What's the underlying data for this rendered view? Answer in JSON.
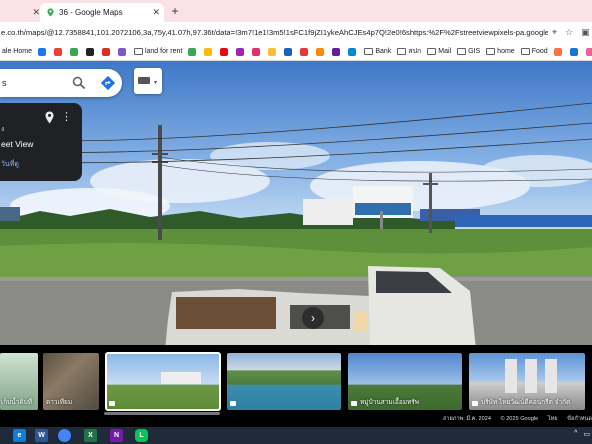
{
  "browser": {
    "tabs": [
      {
        "title": "",
        "active": false
      },
      {
        "title": "36 - Google Maps",
        "active": true
      }
    ],
    "url": "e.co.th/maps/@12.7358841,101.2072106,3a,75y,41.07h,97.36t/data=!3m7!1e1!3m5!1sFC1f9jZI1ykeAhCJEs4p7Q!2e0!6shttps:%2F%2Fstreetviewpixels-pa.googleapis.com%2..."
  },
  "bookmarks": [
    {
      "label": "ale Home",
      "icon": "home",
      "color": "#1a73e8"
    },
    {
      "label": "",
      "icon": "facebook-icon",
      "color": "#1877f2"
    },
    {
      "label": "",
      "icon": "google-icon",
      "color": "#ea4335"
    },
    {
      "label": "",
      "icon": "drive-icon",
      "color": "#34a853"
    },
    {
      "label": "",
      "icon": "s-icon",
      "color": "#222222"
    },
    {
      "label": "",
      "icon": "mail-icon",
      "color": "#d93025"
    },
    {
      "label": "",
      "icon": "app-icon",
      "color": "#7e57c2"
    },
    {
      "label": "land for rent",
      "icon": "folder",
      "color": "#5f6368"
    },
    {
      "label": "",
      "icon": "app-icon",
      "color": "#34a853"
    },
    {
      "label": "",
      "icon": "app-icon",
      "color": "#fbbc04"
    },
    {
      "label": "",
      "icon": "netflix-icon",
      "color": "#e50914"
    },
    {
      "label": "",
      "icon": "app-icon",
      "color": "#9c27b0"
    },
    {
      "label": "",
      "icon": "instagram-icon",
      "color": "#e1306c"
    },
    {
      "label": "",
      "icon": "app-icon",
      "color": "#fbc02d"
    },
    {
      "label": "",
      "icon": "app-icon",
      "color": "#1565c0"
    },
    {
      "label": "",
      "icon": "app-icon",
      "color": "#e53935"
    },
    {
      "label": "",
      "icon": "app-icon",
      "color": "#fb8c00"
    },
    {
      "label": "",
      "icon": "app-icon",
      "color": "#6a1b9a"
    },
    {
      "label": "",
      "icon": "app-icon",
      "color": "#0288d1"
    },
    {
      "label": "Bank",
      "icon": "folder",
      "color": "#5f6368"
    },
    {
      "label": "สปก",
      "icon": "folder",
      "color": "#5f6368"
    },
    {
      "label": "Mail",
      "icon": "folder",
      "color": "#5f6368"
    },
    {
      "label": "GIS",
      "icon": "folder",
      "color": "#5f6368"
    },
    {
      "label": "home",
      "icon": "folder",
      "color": "#5f6368"
    },
    {
      "label": "Food",
      "icon": "folder",
      "color": "#5f6368"
    },
    {
      "label": "",
      "icon": "app-icon",
      "color": "#ff7043"
    },
    {
      "label": "",
      "icon": "app-icon",
      "color": "#1976d2"
    },
    {
      "label": "",
      "icon": "app-icon",
      "color": "#f06292"
    }
  ],
  "maps": {
    "search_text": "s",
    "card": {
      "line1": "ง",
      "street_view": "eet View",
      "line3": "วันที่ดู"
    }
  },
  "strip": {
    "thumbs": [
      {
        "caption": "เก็บน้ำดิบที่"
      },
      {
        "caption": "ดาวเทียม"
      },
      {
        "caption": ""
      },
      {
        "caption": ""
      },
      {
        "caption": "หมู่บ้านสามเอื้อมทรัพ"
      },
      {
        "caption": "บริษัท ไทยวัฒน์ดีคอนกรีต จำกัด"
      }
    ],
    "footer": {
      "captured": "ถ่ายภาพ: มี.ค. 2024",
      "copyright": "© 2025 Google",
      "terms": "ไทย",
      "privacy": "ข้อกำหนด"
    }
  },
  "taskbar": {
    "apps": [
      {
        "name": "edge",
        "label": "e",
        "color": "#0f7dd7"
      },
      {
        "name": "word",
        "label": "W",
        "color": "#2b579a"
      },
      {
        "name": "chrome",
        "label": "",
        "color": "#4285f4"
      },
      {
        "name": "excel",
        "label": "X",
        "color": "#217346"
      },
      {
        "name": "onenote",
        "label": "N",
        "color": "#7719aa"
      },
      {
        "name": "line",
        "label": "L",
        "color": "#06c755"
      }
    ]
  }
}
